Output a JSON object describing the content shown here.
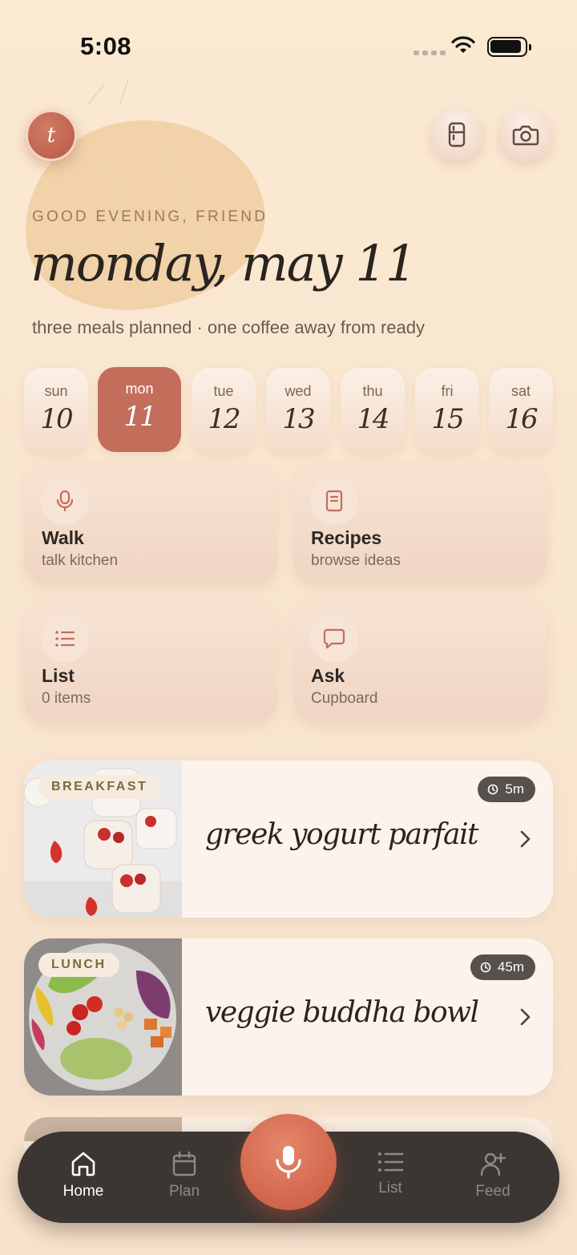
{
  "status": {
    "time": "5:08"
  },
  "header": {
    "avatar_initial": "t",
    "greeting": "GOOD EVENING, FRIEND",
    "date_title": "monday, may 11",
    "subtitle": "three meals planned · one coffee away from ready"
  },
  "week": [
    {
      "name": "sun",
      "num": "10",
      "active": false
    },
    {
      "name": "mon",
      "num": "11",
      "active": true
    },
    {
      "name": "tue",
      "num": "12",
      "active": false
    },
    {
      "name": "wed",
      "num": "13",
      "active": false
    },
    {
      "name": "thu",
      "num": "14",
      "active": false
    },
    {
      "name": "fri",
      "num": "15",
      "active": false
    },
    {
      "name": "sat",
      "num": "16",
      "active": false
    }
  ],
  "tiles": [
    {
      "title": "Walk",
      "sub": "talk kitchen",
      "icon": "mic-icon"
    },
    {
      "title": "Recipes",
      "sub": "browse ideas",
      "icon": "book-icon"
    },
    {
      "title": "List",
      "sub": "0 items",
      "icon": "list-icon"
    },
    {
      "title": "Ask",
      "sub": "Cupboard",
      "icon": "chat-icon"
    }
  ],
  "meals": [
    {
      "tag": "BREAKFAST",
      "title": "greek yogurt parfait",
      "duration": "5m"
    },
    {
      "tag": "LUNCH",
      "title": "veggie buddha bowl",
      "duration": "45m"
    }
  ],
  "nav": {
    "home": "Home",
    "plan": "Plan",
    "list": "List",
    "feed": "Feed"
  },
  "colors": {
    "accent": "#c26e5b",
    "nav_bg": "#3c3632",
    "mic": "#d86a4f"
  }
}
